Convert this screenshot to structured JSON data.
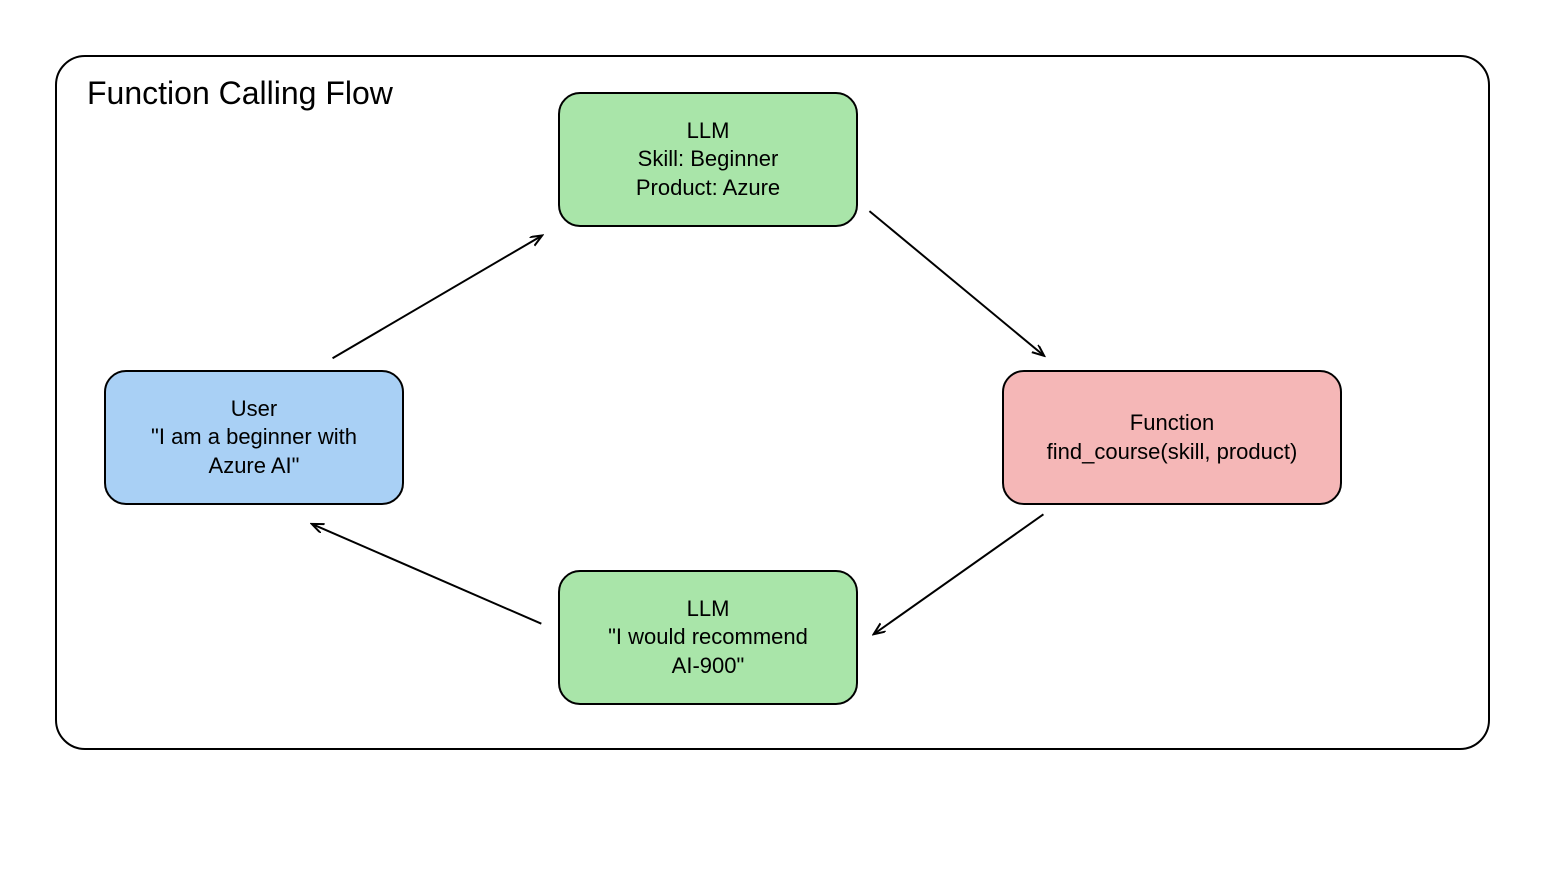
{
  "diagram": {
    "title": "Function Calling Flow",
    "nodes": {
      "user": {
        "line1": "User",
        "line2": "\"I am a beginner with",
        "line3": "Azure AI\""
      },
      "llm_top": {
        "line1": "LLM",
        "line2": "Skill: Beginner",
        "line3": "Product: Azure"
      },
      "function": {
        "line1": "Function",
        "line2": "find_course(skill, product)"
      },
      "llm_bottom": {
        "line1": "LLM",
        "line2": "\"I would recommend",
        "line3": "AI-900\""
      }
    },
    "edges": [
      {
        "from": "user",
        "to": "llm_top"
      },
      {
        "from": "llm_top",
        "to": "function"
      },
      {
        "from": "function",
        "to": "llm_bottom"
      },
      {
        "from": "llm_bottom",
        "to": "user"
      }
    ]
  }
}
